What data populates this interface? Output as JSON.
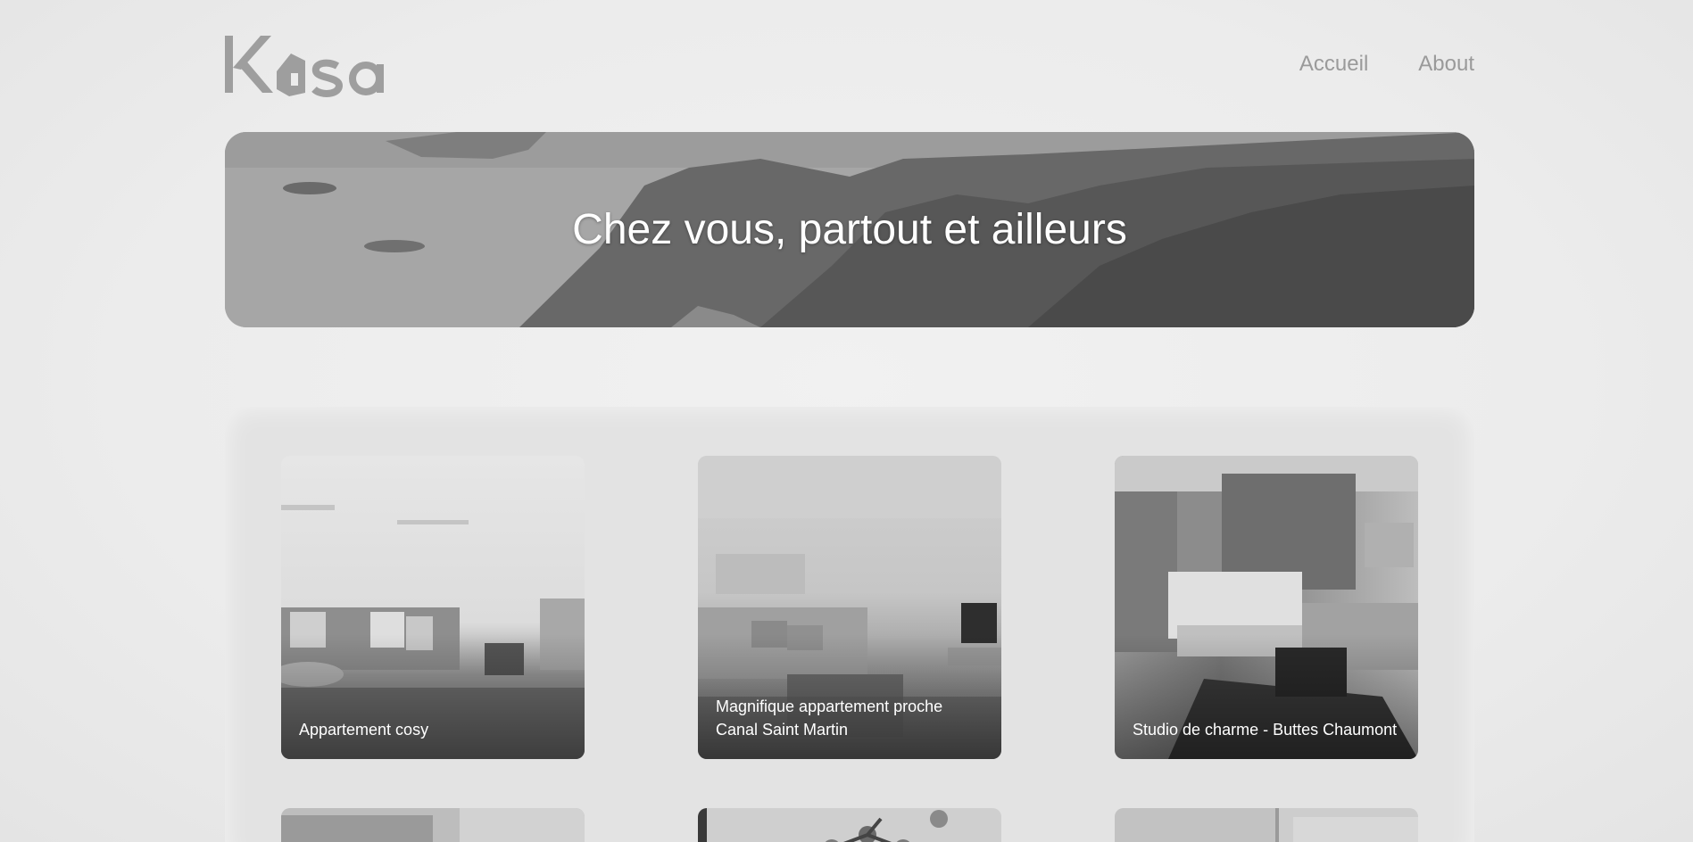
{
  "brand": {
    "logo_text": "Kasa",
    "color": "#9e9e9e"
  },
  "nav": {
    "items": [
      {
        "label": "Accueil"
      },
      {
        "label": "About"
      }
    ]
  },
  "banner": {
    "title": "Chez vous, partout et ailleurs"
  },
  "gallery": {
    "cards": [
      {
        "title": "Appartement cosy"
      },
      {
        "title": "Magnifique appartement proche Canal Saint Martin"
      },
      {
        "title": "Studio de charme - Buttes Chaumont"
      },
      {
        "title": ""
      },
      {
        "title": ""
      },
      {
        "title": ""
      }
    ]
  }
}
